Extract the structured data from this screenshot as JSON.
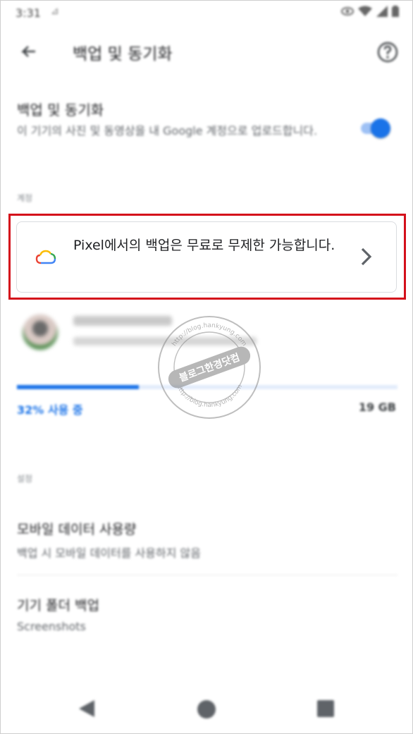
{
  "status_bar": {
    "time": "3:31",
    "notification_icon": "signal-off-icon",
    "icons": [
      "eye-icon",
      "wifi-icon",
      "cellular-icon",
      "battery-icon"
    ]
  },
  "app_bar": {
    "title": "백업 및 동기화",
    "back_icon": "arrow-back-icon",
    "help_icon": "help-circle-icon"
  },
  "backup_toggle": {
    "title": "백업 및 동기화",
    "description": "이 기기의 사진 및 동영상을 내 Google 계정으로 업로드합니다.",
    "enabled": true
  },
  "account_section": {
    "label": "계정",
    "promo_card": {
      "icon": "google-cloud-icon",
      "text": "Pixel에서의 백업은 무료로 무제한 가능합니다.",
      "chevron_icon": "chevron-right-icon"
    },
    "storage": {
      "used_label": "32% 사용 중",
      "used_fraction": 0.32,
      "total_label": "19 GB"
    }
  },
  "settings_section": {
    "label": "설정",
    "items": [
      {
        "title": "모바일 데이터 사용량",
        "subtitle": "백업 시 모바일 데이터를 사용하지 않음"
      },
      {
        "title": "기기 폴더 백업",
        "subtitle": "Screenshots"
      }
    ]
  },
  "watermark": {
    "center_text": "블로그한경닷컴",
    "ring_text": "http://blog.hankyung.com"
  },
  "colors": {
    "accent": "#1a73e8",
    "highlight": "#d4101b"
  }
}
